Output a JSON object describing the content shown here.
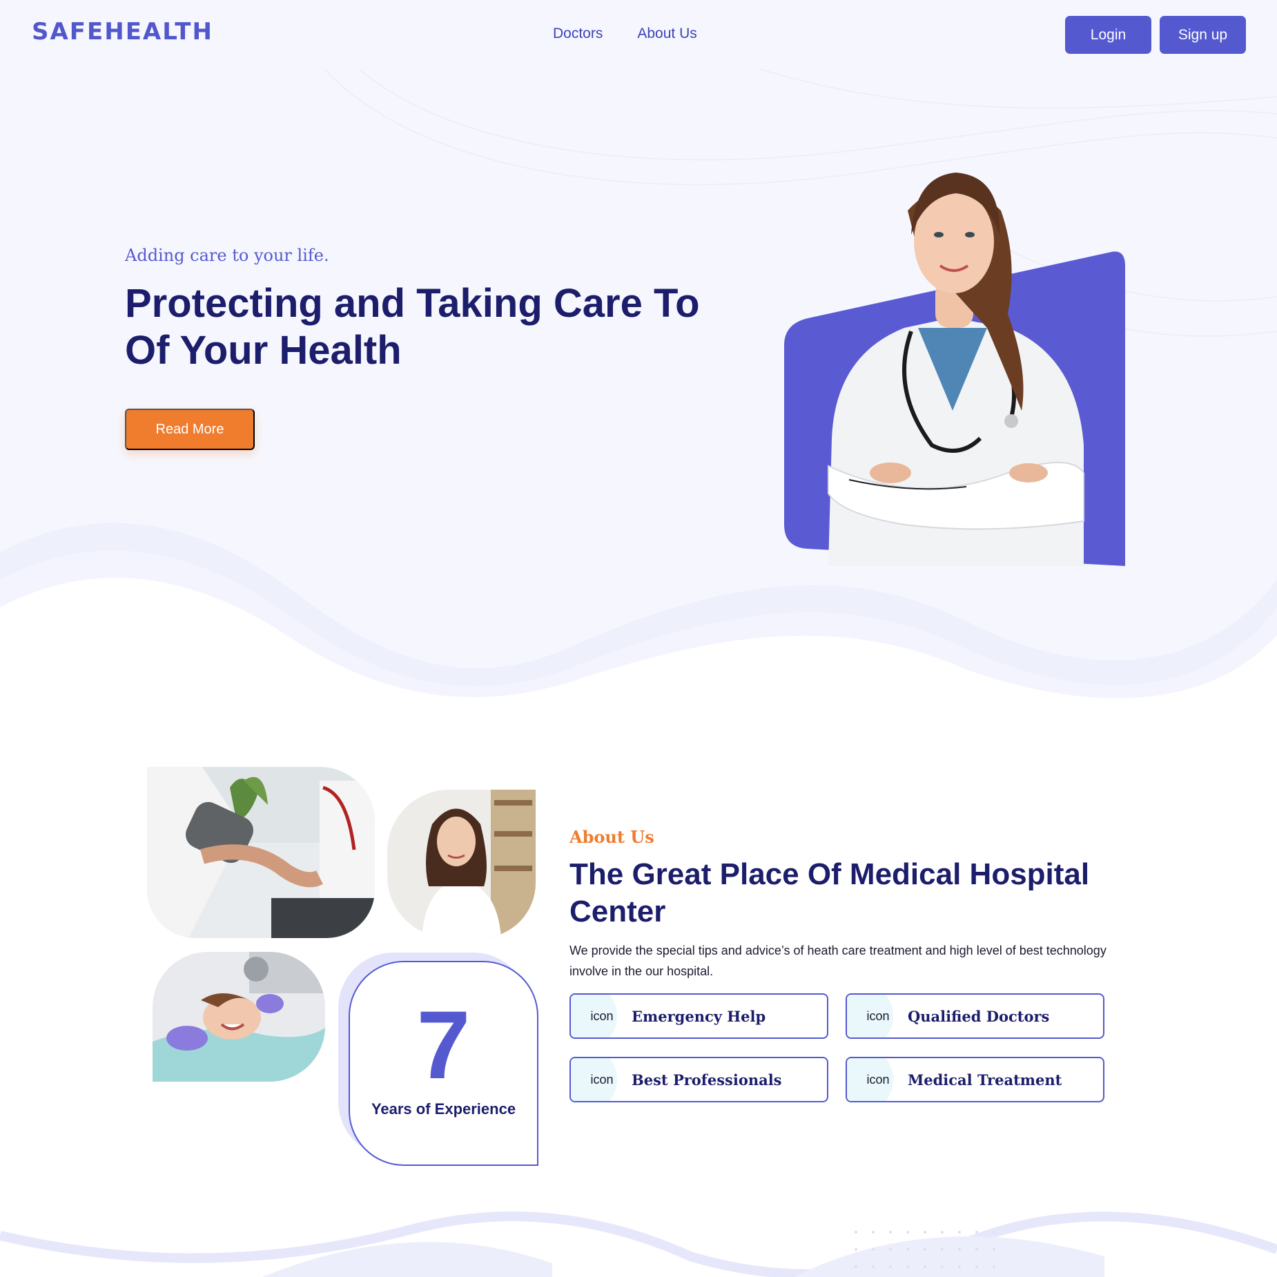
{
  "header": {
    "logo": "SAFEHEALTH",
    "nav": [
      {
        "label": "Doctors"
      },
      {
        "label": "About Us"
      }
    ],
    "login_label": "Login",
    "signup_label": "Sign up"
  },
  "hero": {
    "tagline": "Adding care to your life.",
    "title": "Protecting and Taking Care To Of Your Health",
    "read_more_label": "Read More"
  },
  "about": {
    "eyebrow": "About Us",
    "title": "The Great Place Of Medical Hospital Center",
    "description": "We provide the special tips and advice’s of heath care treatment and high level of best technology involve in the our hospital.",
    "experience": {
      "number": "7",
      "label": "Years of Experience"
    },
    "features": [
      {
        "icon_text": "icon",
        "label": "Emergency Help"
      },
      {
        "icon_text": "icon",
        "label": "Qualified Doctors"
      },
      {
        "icon_text": "icon",
        "label": "Best Professionals"
      },
      {
        "icon_text": "icon",
        "label": "Medical Treatment"
      }
    ]
  },
  "colors": {
    "accent": "#5459d0",
    "heading": "#1c1d6b",
    "orange": "#f07c2e",
    "hero_bg": "#f6f7fe"
  }
}
